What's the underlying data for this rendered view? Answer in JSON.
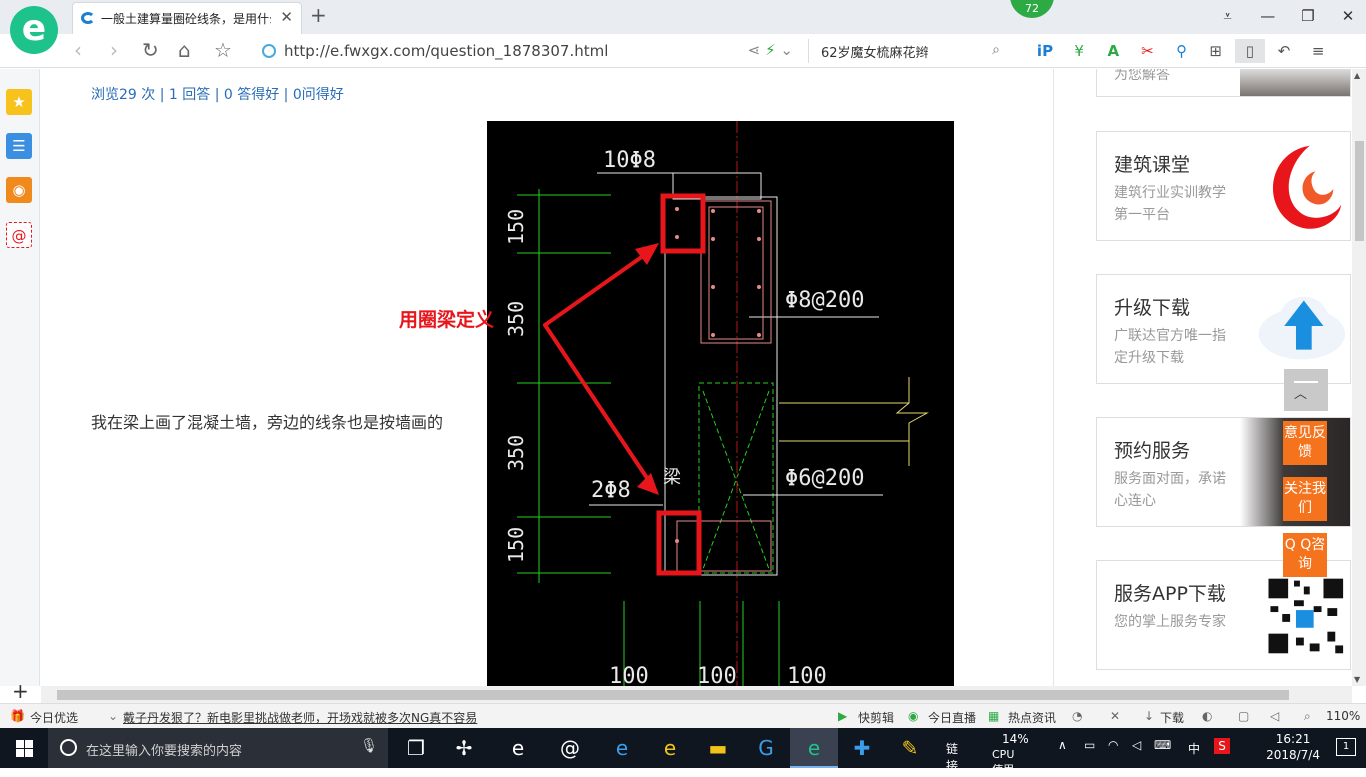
{
  "tab": {
    "title": "一般土建算量圈砼线条，是用什么",
    "close": "✕",
    "new": "+"
  },
  "toolbar_badge": "72",
  "window": {
    "caret": "⩡",
    "minimize": "—",
    "restore": "❐",
    "close": "✕"
  },
  "nav": {
    "back": "‹",
    "forward": "›",
    "reload": "↻",
    "home": "⌂",
    "favorite": "☆"
  },
  "address": {
    "url": "http://e.fwxgx.com/question_1878307.html",
    "share": "⋖",
    "bolt": "⚡",
    "dropdown": "⌄"
  },
  "search": {
    "query": "62岁魔女梳麻花辫",
    "icon": "⌕"
  },
  "extensions": [
    "iP",
    "¥",
    "A",
    "✂",
    "⚲",
    "⊞",
    "▯",
    "↶",
    "≡"
  ],
  "sidebar": {
    "add": "+"
  },
  "page": {
    "stats": "浏览29 次 | 1 回答 | 0 答得好 | 0问得好",
    "question_text": "我在梁上画了混凝土墙，旁边的线条也是按墙画的",
    "overlay_label": "用圈梁定义"
  },
  "cad": {
    "top_rebar": "10Φ8",
    "bottom_rebar": "2Φ8",
    "beam_label": "梁",
    "stirrup_top": "Φ8@200",
    "stirrup_bottom": "Φ6@200",
    "dim_vertical": [
      "150",
      "350",
      "350",
      "150"
    ],
    "dim_bottom": [
      "100",
      "100",
      "100"
    ]
  },
  "cards": [
    {
      "title": "",
      "desc": "为您解答"
    },
    {
      "title": "建筑课堂",
      "desc": "建筑行业实训教学第一平台"
    },
    {
      "title": "升级下载",
      "desc": "广联达官方唯一指定升级下载"
    },
    {
      "title": "预约服务",
      "desc": "服务面对面，承诺心连心"
    },
    {
      "title": "服务APP下载",
      "desc": "您的掌上服务专家"
    }
  ],
  "float_buttons": [
    "意见反馈",
    "关注我们",
    "Q Q咨询"
  ],
  "statusbar": {
    "today": "今日优选",
    "news": "戴子丹发狠了？新电影里挑战做老师，开场戏就被多次NG真不容易",
    "items": [
      "快剪辑",
      "今日直播",
      "热点资讯",
      "下载"
    ],
    "zoom": "110%"
  },
  "taskbar": {
    "search_placeholder": "在这里输入你要搜索的内容",
    "link": "链接",
    "cpu": "14%",
    "cpu_label": "CPU使用",
    "ime": "中",
    "time": "16:21",
    "date": "2018/7/4",
    "notifications": "1"
  },
  "colors": {
    "accent": "#1ec28b",
    "link": "#2a6cb6",
    "orange": "#f5731d",
    "red_annot": "#e8161b"
  }
}
